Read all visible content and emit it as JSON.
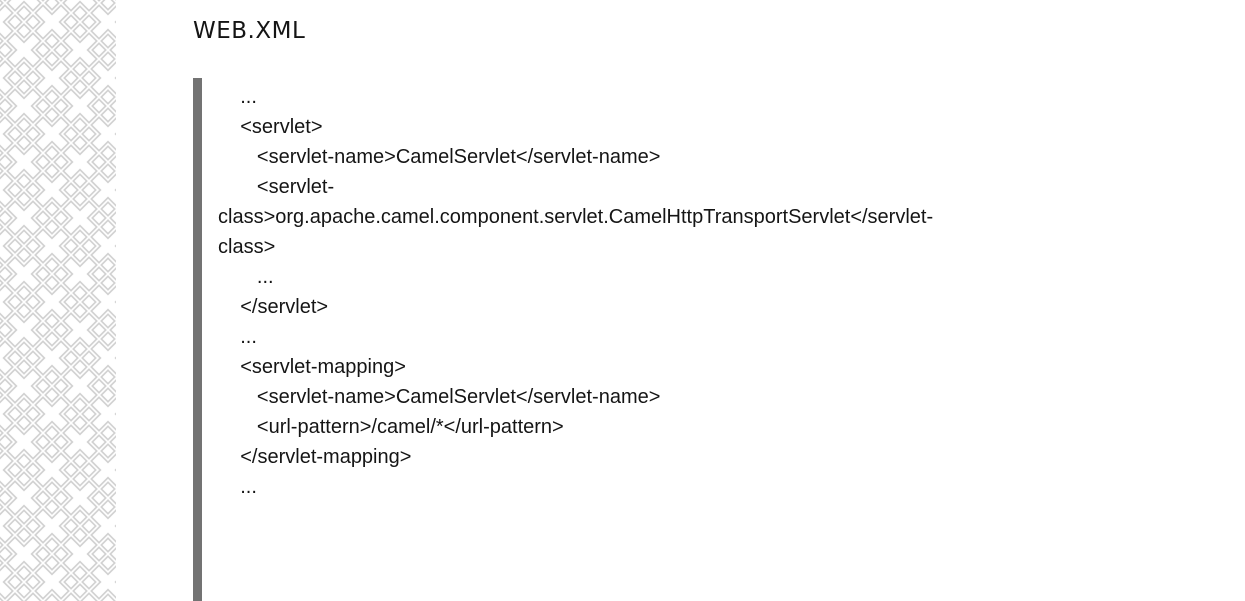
{
  "document": {
    "title": "WEB.XML",
    "code_lines": [
      "    ...",
      "    <servlet>",
      "       <servlet-name>CamelServlet</servlet-name>",
      "       <servlet-",
      "class>org.apache.camel.component.servlet.CamelHttpTransportServlet</servlet-",
      "class>",
      "       ...",
      "    </servlet>",
      "    ...",
      "    <servlet-mapping>",
      "       <servlet-name>CamelServlet</servlet-name>",
      "       <url-pattern>/camel/*</url-pattern>",
      "    </servlet-mapping>",
      "    ..."
    ]
  },
  "decoration": {
    "pattern_icon": "diamond-lattice-pattern",
    "pattern_color": "#d2d2d2",
    "rule_color": "#737373"
  }
}
